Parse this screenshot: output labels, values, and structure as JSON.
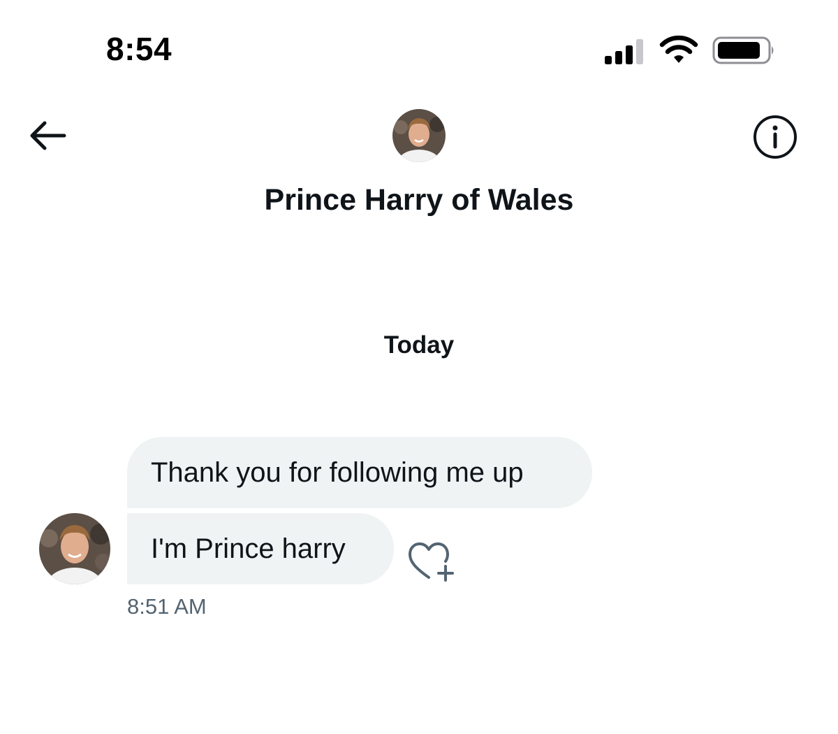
{
  "status_bar": {
    "time": "8:54",
    "icons": [
      "cellular-signal-icon",
      "wifi-icon",
      "battery-icon"
    ]
  },
  "header": {
    "back_icon": "arrow-left-icon",
    "info_icon": "info-circle-icon",
    "contact_name": "Prince Harry of Wales"
  },
  "conversation": {
    "day_label": "Today",
    "messages": [
      {
        "text": "Thank you for following me up"
      },
      {
        "text": "I'm Prince harry"
      }
    ],
    "timestamp": "8:51 AM",
    "reaction_icon": "heart-plus-icon"
  },
  "colors": {
    "bubble_bg": "#eff3f4",
    "primary_text": "#0f1419",
    "secondary_text": "#536471"
  }
}
